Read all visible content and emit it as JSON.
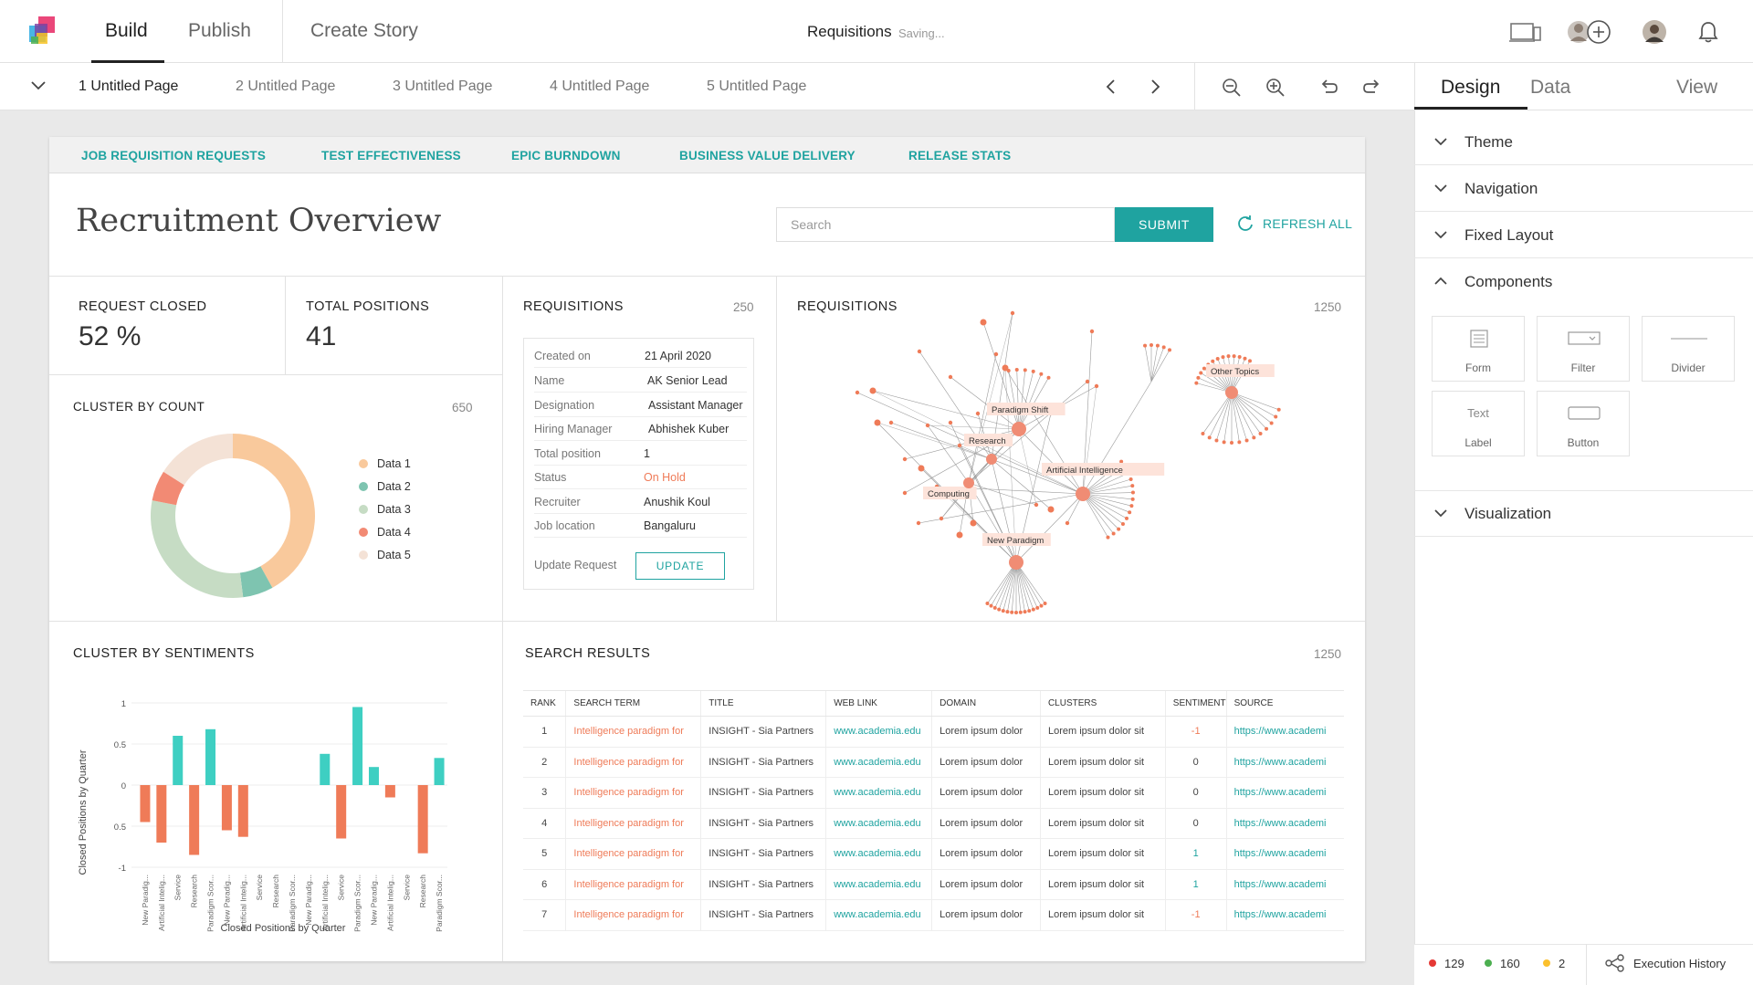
{
  "topbar": {
    "tabs": [
      {
        "label": "Build",
        "active": true
      },
      {
        "label": "Publish"
      },
      {
        "label": "Create Story"
      }
    ],
    "doc_title": "Requisitions",
    "doc_status": "Saving..."
  },
  "pages": [
    {
      "label": "1 Untitled Page",
      "active": true
    },
    {
      "label": "2 Untitled Page"
    },
    {
      "label": "3 Untitled Page"
    },
    {
      "label": "4 Untitled Page"
    },
    {
      "label": "5 Untitled Page"
    }
  ],
  "dashboard": {
    "nav": [
      "JOB REQUISITION REQUESTS",
      "TEST EFFECTIVENESS",
      "EPIC BURNDOWN",
      "BUSINESS VALUE DELIVERY",
      "RELEASE STATS"
    ],
    "title": "Recruitment Overview",
    "search_placeholder": "Search",
    "submit_label": "SUBMIT",
    "refresh_label": "REFRESH ALL",
    "kpis": [
      {
        "label": "REQUEST CLOSED",
        "value": "52 %"
      },
      {
        "label": "TOTAL POSITIONS",
        "value": "41"
      }
    ],
    "requisitions_card": {
      "title": "REQUISITIONS",
      "count": "250",
      "fields": [
        {
          "key": "Created on",
          "value": "21 April 2020"
        },
        {
          "key": "Name",
          "value": "AK Senior Lead"
        },
        {
          "key": "Designation",
          "value": "Assistant Manager"
        },
        {
          "key": "Hiring Manager",
          "value": "Abhishek Kuber"
        },
        {
          "key": "Total position",
          "value": "1"
        },
        {
          "key": "Status",
          "value": "On Hold",
          "color": "#ef7b58"
        },
        {
          "key": "Recruiter",
          "value": "Anushik Koul"
        },
        {
          "key": "Job location",
          "value": "Bangaluru"
        }
      ],
      "update_label": "Update Request",
      "update_button": "UPDATE"
    },
    "network": {
      "title": "REQUISITIONS",
      "count": "1250",
      "labels": [
        "Paradigm Shift",
        "Research",
        "Artificial Intelligence",
        "Computing",
        "New Paradigm",
        "Other Topics"
      ]
    },
    "cluster_count": {
      "title": "CLUSTER BY COUNT",
      "count": "650"
    },
    "cluster_sentiments": {
      "title": "CLUSTER BY SENTIMENTS",
      "count": ""
    },
    "search_results": {
      "title": "SEARCH RESULTS",
      "count": "1250",
      "columns": [
        "RANK",
        "SEARCH TERM",
        "TITLE",
        "WEB LINK",
        "DOMAIN",
        "CLUSTERS",
        "SENTIMENT",
        "SOURCE"
      ],
      "rows": [
        [
          "1",
          "Intelligence paradigm for",
          "INSIGHT - Sia Partners",
          "www.academia.edu",
          "Lorem ipsum dolor",
          "Lorem ipsum dolor sit",
          "-1",
          "https://www.academi"
        ],
        [
          "2",
          "Intelligence paradigm for",
          "INSIGHT - Sia Partners",
          "www.academia.edu",
          "Lorem ipsum dolor",
          "Lorem ipsum dolor sit",
          "0",
          "https://www.academi"
        ],
        [
          "3",
          "Intelligence paradigm for",
          "INSIGHT - Sia Partners",
          "www.academia.edu",
          "Lorem ipsum dolor",
          "Lorem ipsum dolor sit",
          "0",
          "https://www.academi"
        ],
        [
          "4",
          "Intelligence paradigm for",
          "INSIGHT - Sia Partners",
          "www.academia.edu",
          "Lorem ipsum dolor",
          "Lorem ipsum dolor sit",
          "0",
          "https://www.academi"
        ],
        [
          "5",
          "Intelligence paradigm for",
          "INSIGHT - Sia Partners",
          "www.academia.edu",
          "Lorem ipsum dolor",
          "Lorem ipsum dolor sit",
          "1",
          "https://www.academi"
        ],
        [
          "6",
          "Intelligence paradigm for",
          "INSIGHT - Sia Partners",
          "www.academia.edu",
          "Lorem ipsum dolor",
          "Lorem ipsum dolor sit",
          "1",
          "https://www.academi"
        ],
        [
          "7",
          "Intelligence paradigm for",
          "INSIGHT - Sia Partners",
          "www.academia.edu",
          "Lorem ipsum dolor",
          "Lorem ipsum dolor sit",
          "-1",
          "https://www.academi"
        ]
      ]
    }
  },
  "right_panel": {
    "tabs": [
      {
        "label": "Design",
        "active": true
      },
      {
        "label": "Data"
      },
      {
        "label": "View"
      }
    ],
    "sections": [
      "Theme",
      "Navigation",
      "Fixed Layout",
      "Components",
      "Visualization"
    ],
    "expanded_section": "Components",
    "components": [
      {
        "label": "Form",
        "icon": "form-icon"
      },
      {
        "label": "Filter",
        "icon": "filter-icon"
      },
      {
        "label": "Divider",
        "icon": "divider-icon"
      },
      {
        "label": "Label",
        "icon": "text-icon",
        "icon_text": "Text"
      },
      {
        "label": "Button",
        "icon": "button-icon"
      }
    ],
    "status": {
      "red_count": "129",
      "green_count": "160",
      "yellow_count": "2",
      "history_label": "Execution History"
    }
  },
  "colors": {
    "accent": "#1fa3a0",
    "orange": "#ef7b58",
    "error": "#e53935",
    "ok": "#4caf50",
    "warn": "#fbc02d"
  },
  "chart_data": [
    {
      "type": "pie",
      "title": "CLUSTER BY COUNT",
      "donut": true,
      "categories": [
        "Data 1",
        "Data 2",
        "Data 3",
        "Data 4",
        "Data 5"
      ],
      "values": [
        42,
        6,
        30,
        6,
        16
      ],
      "colors": [
        "#f9c99c",
        "#7ec4b0",
        "#c6dcc4",
        "#f28a74",
        "#f4e2d6"
      ],
      "legend": "right"
    },
    {
      "type": "bar",
      "title": "CLUSTER BY SENTIMENTS",
      "xlabel": "Closed Positions by Quarter",
      "ylabel": "Closed Positions by Quarter",
      "ylim": [
        -1,
        1
      ],
      "yticks": [
        "1",
        "0.5",
        "0",
        "0.5",
        "-1"
      ],
      "grid": true,
      "categories": [
        "New Paradig...",
        "Artificial Intelig...",
        "Service",
        "Research",
        "Paradigm Scor...",
        "New Paradig...",
        "Artificial Intelig...",
        "Service",
        "Research",
        "Paradigm Scor...",
        "New Paradig...",
        "Artificial Intelig...",
        "Service",
        "Paradigm Scor...",
        "New Paradig...",
        "Artificial Intelig...",
        "Service",
        "Research",
        "Paradigm Scor..."
      ],
      "series": [
        {
          "color": "#ef7b58",
          "values": [
            -0.45,
            -0.7,
            0,
            -0.85,
            0,
            -0.55,
            -0.63,
            0,
            0,
            0,
            0,
            0,
            -0.65,
            0,
            0,
            -0.15,
            0,
            -0.83,
            0
          ]
        },
        {
          "color": "#3ecfc2",
          "values": [
            0,
            0,
            0.6,
            0,
            0.68,
            0,
            0,
            0,
            0,
            0,
            0,
            0.38,
            0,
            0.95,
            0.22,
            0,
            0,
            0,
            0.33
          ]
        }
      ]
    }
  ]
}
